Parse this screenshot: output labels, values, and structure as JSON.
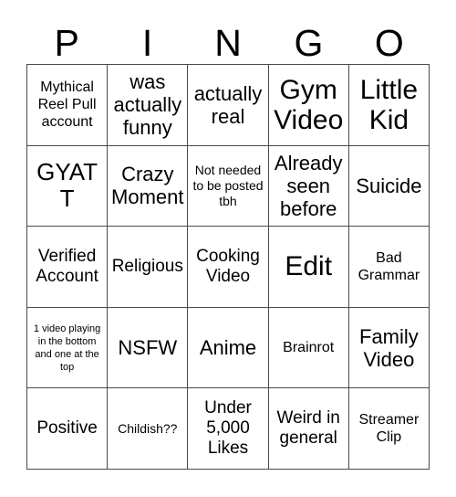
{
  "card": {
    "header_letters": [
      "P",
      "I",
      "N",
      "G",
      "O"
    ],
    "colors": {
      "background": "#ffffff",
      "text": "#000000",
      "grid_line": "#4a4a4a"
    },
    "rows": [
      [
        {
          "text": "Mythical Reel Pull account",
          "size": "sm"
        },
        {
          "text": "was actually funny",
          "size": "lg"
        },
        {
          "text": "actually real",
          "size": "lg"
        },
        {
          "text": "Gym Video",
          "size": "xxl"
        },
        {
          "text": "Little Kid",
          "size": "xxl"
        }
      ],
      [
        {
          "text": "GYATT",
          "size": "xl"
        },
        {
          "text": "Crazy Moment",
          "size": "lg"
        },
        {
          "text": "Not needed to be posted tbh",
          "size": "xs"
        },
        {
          "text": "Already seen before",
          "size": "lg"
        },
        {
          "text": "Suicide",
          "size": "lg"
        }
      ],
      [
        {
          "text": "Verified Account",
          "size": "md"
        },
        {
          "text": "Religious",
          "size": "md"
        },
        {
          "text": "Cooking Video",
          "size": "md"
        },
        {
          "text": "Edit",
          "size": "xxl"
        },
        {
          "text": "Bad Grammar",
          "size": "sm"
        }
      ],
      [
        {
          "text": "1 video playing in the bottom and one at the top",
          "size": "xxs"
        },
        {
          "text": "NSFW",
          "size": "lg"
        },
        {
          "text": "Anime",
          "size": "lg"
        },
        {
          "text": "Brainrot",
          "size": "sm"
        },
        {
          "text": "Family Video",
          "size": "lg"
        }
      ],
      [
        {
          "text": "Positive",
          "size": "md"
        },
        {
          "text": "Childish??",
          "size": "xs"
        },
        {
          "text": "Under 5,000 Likes",
          "size": "md"
        },
        {
          "text": "Weird in general",
          "size": "md"
        },
        {
          "text": "Streamer Clip",
          "size": "sm"
        }
      ]
    ]
  }
}
